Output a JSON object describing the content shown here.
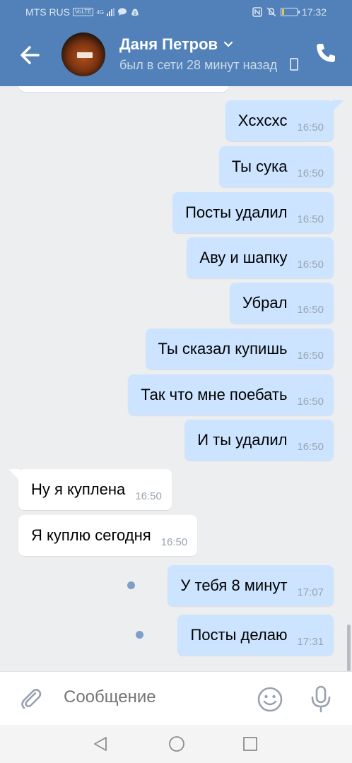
{
  "status_bar": {
    "carrier": "MTS RUS",
    "net_badge": "VoLTE",
    "net_type": "4G",
    "time": "17:32",
    "battery_level": 0.15,
    "icons": [
      "volte-icon",
      "signal-icon",
      "message-icon",
      "money-icon",
      "nfc-icon",
      "mute-icon",
      "battery-icon"
    ]
  },
  "header": {
    "name": "Даня Петров",
    "presence": "был в сети 28 минут назад"
  },
  "messages": [
    {
      "dir": "out",
      "text": "Xcxcxc",
      "time": "16:50",
      "unread": false
    },
    {
      "dir": "out",
      "text": "Ты сука",
      "time": "16:50",
      "unread": false
    },
    {
      "dir": "out",
      "text": "Посты удалил",
      "time": "16:50",
      "unread": false
    },
    {
      "dir": "out",
      "text": "Аву и шапку",
      "time": "16:50",
      "unread": false
    },
    {
      "dir": "out",
      "text": "Убрал",
      "time": "16:50",
      "unread": false
    },
    {
      "dir": "out",
      "text": "Ты сказал купишь",
      "time": "16:50",
      "unread": false
    },
    {
      "dir": "out",
      "text": "Так что мне поебать",
      "time": "16:50",
      "unread": false
    },
    {
      "dir": "out",
      "text": "И ты удалил",
      "time": "16:50",
      "unread": false
    },
    {
      "dir": "in",
      "text": "Ну я куплена",
      "time": "16:50",
      "unread": false
    },
    {
      "dir": "in",
      "text": "Я куплю сегодня",
      "time": "16:50",
      "unread": false
    },
    {
      "dir": "out",
      "text": "У тебя 8 минут",
      "time": "17:07",
      "unread": true
    },
    {
      "dir": "out",
      "text": "Посты делаю",
      "time": "17:31",
      "unread": true
    }
  ],
  "composer": {
    "placeholder": "Сообщение"
  },
  "colors": {
    "header_bg": "#5181b8",
    "outgoing_bubble": "#cce4ff",
    "incoming_bubble": "#ffffff",
    "chat_bg": "#edeef0"
  }
}
